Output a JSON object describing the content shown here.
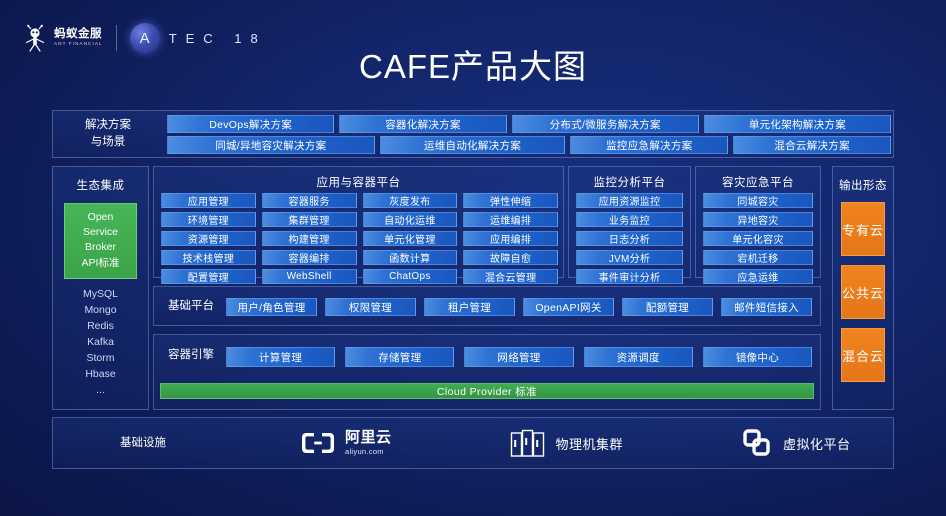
{
  "header": {
    "brand_cn": "蚂蚁金服",
    "brand_en": "ANT FINANCIAL",
    "atec_a": "A",
    "atec_letters": "TEC 18"
  },
  "title": "CAFE产品大图",
  "solutions": {
    "label": "解决方案\n与场景",
    "label_line1": "解决方案",
    "label_line2": "与场景",
    "row1": [
      {
        "label": "DevOps解决方案",
        "flex": 1
      },
      {
        "label": "容器化解决方案",
        "flex": 1
      },
      {
        "label": "分布式/微服务解决方案",
        "flex": 1.12
      },
      {
        "label": "单元化架构解决方案",
        "flex": 1.12
      }
    ],
    "row2": [
      {
        "label": "同城/异地容灾解决方案",
        "flex": 1.32
      },
      {
        "label": "运维自动化解决方案",
        "flex": 1.18
      },
      {
        "label": "监控应急解决方案",
        "flex": 1
      },
      {
        "label": "混合云解决方案",
        "flex": 1
      }
    ]
  },
  "ecosystem": {
    "title": "生态集成",
    "osb_lines": [
      "Open",
      "Service",
      "Broker",
      "API标准"
    ],
    "items": [
      "MySQL",
      "Mongo",
      "Redis",
      "Kafka",
      "Storm",
      "Hbase",
      "..."
    ]
  },
  "app_platform": {
    "title": "应用与容器平台",
    "items": [
      "应用管理",
      "容器服务",
      "灰度发布",
      "弹性伸缩",
      "环境管理",
      "集群管理",
      "自动化运维",
      "运维编排",
      "资源管理",
      "构建管理",
      "单元化管理",
      "应用编排",
      "技术栈管理",
      "容器编排",
      "函数计算",
      "故障自愈",
      "配置管理",
      "WebShell",
      "ChatOps",
      "混合云管理"
    ]
  },
  "monitor_platform": {
    "title": "监控分析平台",
    "items": [
      "应用资源监控",
      "业务监控",
      "日志分析",
      "JVM分析",
      "事件审计分析"
    ]
  },
  "disaster_platform": {
    "title": "容灾应急平台",
    "items": [
      "同城容灾",
      "异地容灾",
      "单元化容灾",
      "宕机迁移",
      "应急运维"
    ]
  },
  "output_forms": {
    "title": "输出形态",
    "items": [
      "专有云",
      "公共云",
      "混合云"
    ]
  },
  "base_platform": {
    "label": "基础平台",
    "items": [
      "用户/角色管理",
      "权限管理",
      "租户管理",
      "OpenAPI网关",
      "配额管理",
      "邮件短信接入"
    ]
  },
  "container_engine": {
    "label": "容器引擎",
    "items": [
      "计算管理",
      "存储管理",
      "网络管理",
      "资源调度",
      "镜像中心"
    ],
    "cloud_provider_bar": "Cloud Provider 标准"
  },
  "infrastructure": {
    "label": "基础设施",
    "items": [
      {
        "name": "阿里云",
        "sub": "aliyun.com",
        "icon": "aliyun-logo-icon"
      },
      {
        "name": "物理机集群",
        "icon": "server-rack-icon"
      },
      {
        "name": "虚拟化平台",
        "icon": "virtualization-icon"
      }
    ]
  },
  "colors": {
    "background": "#0d1a52",
    "chip_blue": "#2f72d4",
    "green": "#41ac52",
    "orange": "#ef8420",
    "accent_text": "#ffffff"
  }
}
